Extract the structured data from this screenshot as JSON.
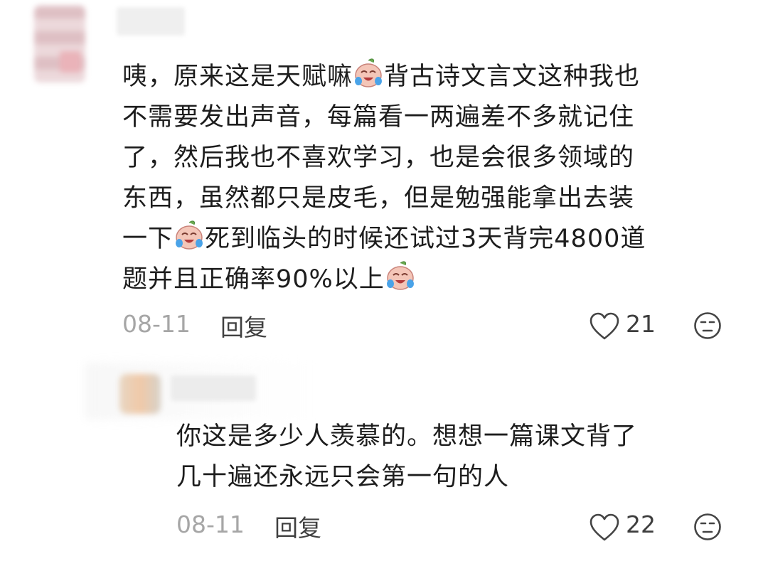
{
  "comments": [
    {
      "lines": [
        "咦，原来这是天赋嘛",
        "背古诗文言文这种我也",
        "不需要发出声音，每篇看一两遍差不多就记住",
        "了，然后我也不喜欢学习，也是会很多领域的",
        "东西，虽然都只是皮毛，但是勉强能拿出去装",
        "一下",
        "死到临头的时候还试过3天背完4800道",
        "题并且正确率90%以上"
      ],
      "date": "08-11",
      "reply_label": "回复",
      "likes": "21"
    },
    {
      "lines": [
        "你这是多少人羡慕的。想想一篇课文背了",
        "几十遍还永远只会第一句的人"
      ],
      "date": "08-11",
      "reply_label": "回复",
      "likes": "22"
    }
  ],
  "icons": {
    "emoji": "crying-laughing-emoji",
    "like": "heart-outline-icon",
    "dislike": "neutral-face-icon"
  }
}
